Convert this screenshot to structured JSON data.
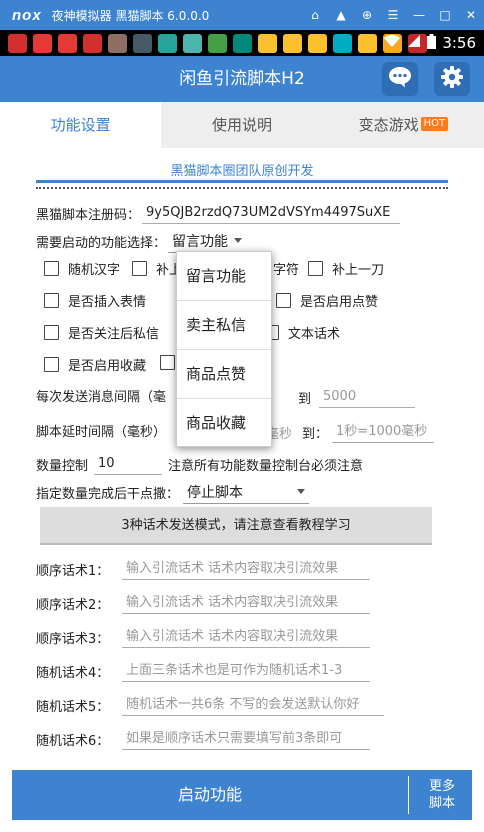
{
  "emulator": {
    "logo": "nox",
    "title": "夜神模拟器 黑猫脚本 6.0.0.0"
  },
  "status_bar": {
    "time": "3:56",
    "app_icons": [
      "#d32f2f",
      "#e53935",
      "#e53935",
      "#d32f2f",
      "#8d6e63",
      "#455a64",
      "#26a69a",
      "#4db6ac",
      "#43a047",
      "#00897b",
      "#fbc02d",
      "#fbc02d",
      "#fbc02d",
      "#00acc1",
      "#fbc02d",
      "#f9a825",
      "#c62828"
    ]
  },
  "header": {
    "title": "闲鱼引流脚本H2"
  },
  "tabs": [
    {
      "label": "功能设置"
    },
    {
      "label": "使用说明"
    },
    {
      "label": "变态游戏",
      "badge": "HOT"
    }
  ],
  "panel": {
    "title": "黑猫脚本圈团队原创开发"
  },
  "form": {
    "reg_label": "黑猫脚本注册码：",
    "reg_value": "9y5QJB2rzdQ73UM2dVSYm4497SuXE",
    "feature_label": "需要启动的功能选择：",
    "feature_selected": "留言功能",
    "checkboxes": {
      "c1": "随机汉字",
      "c2": "补上",
      "c3": "字符",
      "c4": "补上一刀",
      "c5": "是否插入表情",
      "c6": "是否启用点赞",
      "c7": "是否关注后私信",
      "c8": "文本话术",
      "c9": "是否启用收藏"
    },
    "interval_label": "每次发送消息间隔（毫",
    "interval_to": "到",
    "interval_max_placeholder": "5000",
    "delay_label": "脚本延时间隔（毫秒）",
    "delay_frag": "毫秒",
    "delay_to": "到：",
    "delay_max_placeholder": "1秒=1000毫秒",
    "qty_label": "数量控制",
    "qty_value": "10",
    "qty_note": "注意所有功能数量控制台必须注意",
    "after_label": "指定数量完成后干点撒：",
    "after_selected": "停止脚本",
    "mode_button": "3种话术发送模式，请注意查看教程学习",
    "phrases": [
      {
        "label": "顺序话术1：",
        "placeholder": "输入引流话术  话术内容取决引流效果"
      },
      {
        "label": "顺序话术2：",
        "placeholder": "输入引流话术  话术内容取决引流效果"
      },
      {
        "label": "顺序话术3：",
        "placeholder": "输入引流话术  话术内容取决引流效果"
      },
      {
        "label": "随机话术4：",
        "placeholder": "上面三条话术也是可作为随机话术1-3"
      },
      {
        "label": "随机话术5：",
        "placeholder": "随机话术一共6条 不写的会发送默认你好"
      },
      {
        "label": "随机话术6：",
        "placeholder": "如果是顺序话术只需要填写前3条即可"
      }
    ]
  },
  "dropdown": {
    "options": [
      "留言功能",
      "卖主私信",
      "商品点赞",
      "商品收藏"
    ]
  },
  "bottom": {
    "start_label": "启动功能",
    "more_line1": "更多",
    "more_line2": "脚本"
  }
}
